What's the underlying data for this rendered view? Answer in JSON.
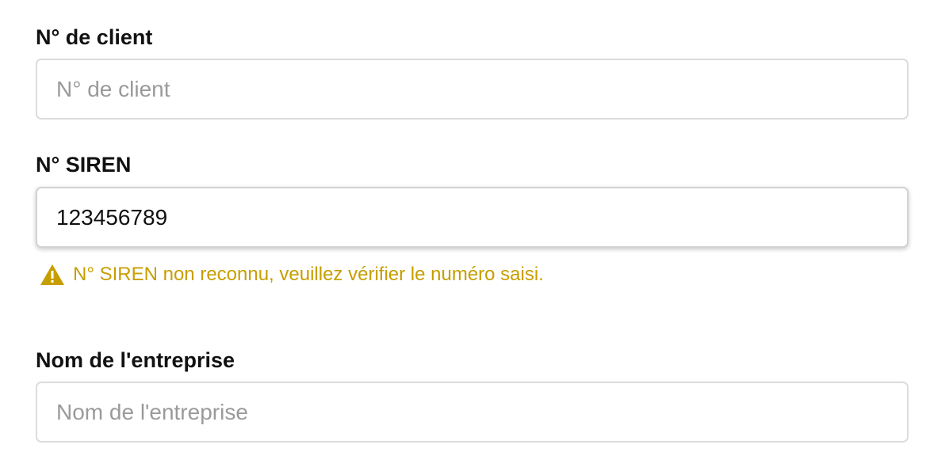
{
  "client_number": {
    "label": "N° de client",
    "placeholder": "N° de client",
    "value": ""
  },
  "siren": {
    "label": "N° SIREN",
    "placeholder": "",
    "value": "123456789",
    "warning": {
      "icon": "warning-triangle-icon",
      "text": "N° SIREN non reconnu, veuillez vérifier le numéro saisi.",
      "color": "#c79e00"
    }
  },
  "company_name": {
    "label": "Nom de l'entreprise",
    "placeholder": "Nom de l'entreprise",
    "value": ""
  }
}
